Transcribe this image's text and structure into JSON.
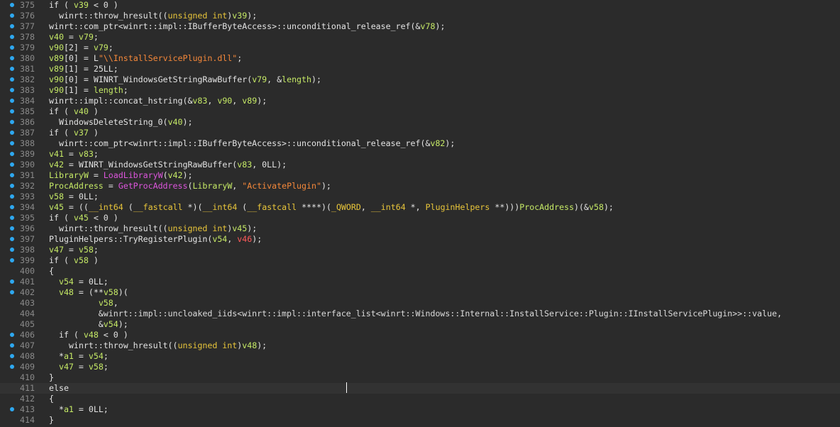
{
  "colors": {
    "background": "#2b2b2b",
    "current_line": "#323232",
    "breakpoint_dot": "#2ea8f0",
    "line_number": "#8a8a8a",
    "plain": "#e3e3e3",
    "variable": "#c6ea66",
    "keyword_type": "#e8c53a",
    "string": "#f5883a",
    "function": "#dd55dd",
    "global": "#dcdcdc",
    "highlight": "#ff5a5a"
  },
  "lines": [
    {
      "num": "375",
      "dot": true,
      "tokens": [
        [
          "p",
          "if ( "
        ],
        [
          "v",
          "v39"
        ],
        [
          "p",
          " < 0 )"
        ]
      ]
    },
    {
      "num": "376",
      "dot": true,
      "tokens": [
        [
          "p",
          "  winrt::throw_hresult(("
        ],
        [
          "k",
          "unsigned int"
        ],
        [
          "p",
          ")"
        ],
        [
          "v",
          "v39"
        ],
        [
          "p",
          ");"
        ]
      ]
    },
    {
      "num": "377",
      "dot": true,
      "tokens": [
        [
          "p",
          "winrt::com_ptr<winrt::impl::IBufferByteAccess>::unconditional_release_ref(&"
        ],
        [
          "v",
          "v78"
        ],
        [
          "p",
          ");"
        ]
      ]
    },
    {
      "num": "378",
      "dot": true,
      "tokens": [
        [
          "v",
          "v40"
        ],
        [
          "p",
          " = "
        ],
        [
          "v",
          "v79"
        ],
        [
          "p",
          ";"
        ]
      ]
    },
    {
      "num": "379",
      "dot": true,
      "tokens": [
        [
          "v",
          "v90"
        ],
        [
          "p",
          "[2] = "
        ],
        [
          "v",
          "v79"
        ],
        [
          "p",
          ";"
        ]
      ]
    },
    {
      "num": "380",
      "dot": true,
      "tokens": [
        [
          "v",
          "v89"
        ],
        [
          "p",
          "[0] = L"
        ],
        [
          "s",
          "\"\\\\InstallServicePlugin.dll\""
        ],
        [
          "p",
          ";"
        ]
      ]
    },
    {
      "num": "381",
      "dot": true,
      "tokens": [
        [
          "v",
          "v89"
        ],
        [
          "p",
          "[1] = 25LL;"
        ]
      ]
    },
    {
      "num": "382",
      "dot": true,
      "tokens": [
        [
          "v",
          "v90"
        ],
        [
          "p",
          "[0] = WINRT_WindowsGetStringRawBuffer("
        ],
        [
          "v",
          "v79"
        ],
        [
          "p",
          ", &"
        ],
        [
          "v",
          "length"
        ],
        [
          "p",
          ");"
        ]
      ]
    },
    {
      "num": "383",
      "dot": true,
      "tokens": [
        [
          "v",
          "v90"
        ],
        [
          "p",
          "[1] = "
        ],
        [
          "v",
          "length"
        ],
        [
          "p",
          ";"
        ]
      ]
    },
    {
      "num": "384",
      "dot": true,
      "tokens": [
        [
          "p",
          "winrt::impl::concat_hstring(&"
        ],
        [
          "v",
          "v83"
        ],
        [
          "p",
          ", "
        ],
        [
          "v",
          "v90"
        ],
        [
          "p",
          ", "
        ],
        [
          "v",
          "v89"
        ],
        [
          "p",
          ");"
        ]
      ]
    },
    {
      "num": "385",
      "dot": true,
      "tokens": [
        [
          "p",
          "if ( "
        ],
        [
          "v",
          "v40"
        ],
        [
          "p",
          " )"
        ]
      ]
    },
    {
      "num": "386",
      "dot": true,
      "tokens": [
        [
          "p",
          "  WindowsDeleteString_0("
        ],
        [
          "v",
          "v40"
        ],
        [
          "p",
          ");"
        ]
      ]
    },
    {
      "num": "387",
      "dot": true,
      "tokens": [
        [
          "p",
          "if ( "
        ],
        [
          "v",
          "v37"
        ],
        [
          "p",
          " )"
        ]
      ]
    },
    {
      "num": "388",
      "dot": true,
      "tokens": [
        [
          "p",
          "  winrt::com_ptr<winrt::impl::IBufferByteAccess>::unconditional_release_ref(&"
        ],
        [
          "v",
          "v82"
        ],
        [
          "p",
          ");"
        ]
      ]
    },
    {
      "num": "389",
      "dot": true,
      "tokens": [
        [
          "v",
          "v41"
        ],
        [
          "p",
          " = "
        ],
        [
          "v",
          "v83"
        ],
        [
          "p",
          ";"
        ]
      ]
    },
    {
      "num": "390",
      "dot": true,
      "tokens": [
        [
          "v",
          "v42"
        ],
        [
          "p",
          " = WINRT_WindowsGetStringRawBuffer("
        ],
        [
          "v",
          "v83"
        ],
        [
          "p",
          ", 0LL);"
        ]
      ]
    },
    {
      "num": "391",
      "dot": true,
      "tokens": [
        [
          "v",
          "LibraryW"
        ],
        [
          "p",
          " = "
        ],
        [
          "f",
          "LoadLibraryW"
        ],
        [
          "p",
          "("
        ],
        [
          "v",
          "v42"
        ],
        [
          "p",
          ");"
        ]
      ]
    },
    {
      "num": "392",
      "dot": true,
      "tokens": [
        [
          "v",
          "ProcAddress"
        ],
        [
          "p",
          " = "
        ],
        [
          "f",
          "GetProcAddress"
        ],
        [
          "p",
          "("
        ],
        [
          "v",
          "LibraryW"
        ],
        [
          "p",
          ", "
        ],
        [
          "s",
          "\"ActivatePlugin\""
        ],
        [
          "p",
          ");"
        ]
      ]
    },
    {
      "num": "393",
      "dot": true,
      "tokens": [
        [
          "v",
          "v58"
        ],
        [
          "p",
          " = 0LL;"
        ]
      ]
    },
    {
      "num": "394",
      "dot": true,
      "tokens": [
        [
          "v",
          "v45"
        ],
        [
          "p",
          " = (("
        ],
        [
          "k",
          "__int64"
        ],
        [
          "p",
          " ("
        ],
        [
          "k",
          "__fastcall"
        ],
        [
          "p",
          " *)("
        ],
        [
          "k",
          "__int64"
        ],
        [
          "p",
          " ("
        ],
        [
          "k",
          "__fastcall"
        ],
        [
          "p",
          " ****)("
        ],
        [
          "k",
          "_QWORD"
        ],
        [
          "p",
          ", "
        ],
        [
          "k",
          "__int64"
        ],
        [
          "p",
          " *, "
        ],
        [
          "k",
          "PluginHelpers"
        ],
        [
          "p",
          " **)))"
        ],
        [
          "v",
          "ProcAddress"
        ],
        [
          "p",
          ")(&"
        ],
        [
          "v",
          "v58"
        ],
        [
          "p",
          ");"
        ]
      ]
    },
    {
      "num": "395",
      "dot": true,
      "tokens": [
        [
          "p",
          "if ( "
        ],
        [
          "v",
          "v45"
        ],
        [
          "p",
          " < 0 )"
        ]
      ]
    },
    {
      "num": "396",
      "dot": true,
      "tokens": [
        [
          "p",
          "  winrt::throw_hresult(("
        ],
        [
          "k",
          "unsigned int"
        ],
        [
          "p",
          ")"
        ],
        [
          "v",
          "v45"
        ],
        [
          "p",
          ");"
        ]
      ]
    },
    {
      "num": "397",
      "dot": true,
      "tokens": [
        [
          "p",
          "PluginHelpers::TryRegisterPlugin("
        ],
        [
          "v",
          "v54"
        ],
        [
          "p",
          ", "
        ],
        [
          "r",
          "v46"
        ],
        [
          "p",
          ");"
        ]
      ]
    },
    {
      "num": "398",
      "dot": true,
      "tokens": [
        [
          "v",
          "v47"
        ],
        [
          "p",
          " = "
        ],
        [
          "v",
          "v58"
        ],
        [
          "p",
          ";"
        ]
      ]
    },
    {
      "num": "399",
      "dot": true,
      "tokens": [
        [
          "p",
          "if ( "
        ],
        [
          "v",
          "v58"
        ],
        [
          "p",
          " )"
        ]
      ]
    },
    {
      "num": "400",
      "dot": false,
      "tokens": [
        [
          "p",
          "{"
        ]
      ]
    },
    {
      "num": "401",
      "dot": true,
      "tokens": [
        [
          "p",
          "  "
        ],
        [
          "v",
          "v54"
        ],
        [
          "p",
          " = 0LL;"
        ]
      ]
    },
    {
      "num": "402",
      "dot": true,
      "tokens": [
        [
          "p",
          "  "
        ],
        [
          "v",
          "v48"
        ],
        [
          "p",
          " = (**"
        ],
        [
          "v",
          "v58"
        ],
        [
          "p",
          ")("
        ]
      ]
    },
    {
      "num": "403",
      "dot": false,
      "tokens": [
        [
          "p",
          "          "
        ],
        [
          "v",
          "v58"
        ],
        [
          "p",
          ","
        ]
      ]
    },
    {
      "num": "404",
      "dot": false,
      "tokens": [
        [
          "p",
          "          &"
        ],
        [
          "g",
          "winrt::impl::uncloaked_iids<winrt::impl::interface_list<winrt::Windows::Internal::InstallService::Plugin::IInstallServicePlugin>>::value"
        ],
        [
          "p",
          ","
        ]
      ]
    },
    {
      "num": "405",
      "dot": false,
      "tokens": [
        [
          "p",
          "          &"
        ],
        [
          "v",
          "v54"
        ],
        [
          "p",
          ");"
        ]
      ]
    },
    {
      "num": "406",
      "dot": true,
      "tokens": [
        [
          "p",
          "  if ( "
        ],
        [
          "v",
          "v48"
        ],
        [
          "p",
          " < 0 )"
        ]
      ]
    },
    {
      "num": "407",
      "dot": true,
      "tokens": [
        [
          "p",
          "    winrt::throw_hresult(("
        ],
        [
          "k",
          "unsigned int"
        ],
        [
          "p",
          ")"
        ],
        [
          "v",
          "v48"
        ],
        [
          "p",
          ");"
        ]
      ]
    },
    {
      "num": "408",
      "dot": true,
      "tokens": [
        [
          "p",
          "  *"
        ],
        [
          "v",
          "a1"
        ],
        [
          "p",
          " = "
        ],
        [
          "v",
          "v54"
        ],
        [
          "p",
          ";"
        ]
      ]
    },
    {
      "num": "409",
      "dot": true,
      "tokens": [
        [
          "p",
          "  "
        ],
        [
          "v",
          "v47"
        ],
        [
          "p",
          " = "
        ],
        [
          "v",
          "v58"
        ],
        [
          "p",
          ";"
        ]
      ]
    },
    {
      "num": "410",
      "dot": false,
      "tokens": [
        [
          "p",
          "}"
        ]
      ]
    },
    {
      "num": "411",
      "dot": false,
      "current": true,
      "tokens": [
        [
          "p",
          "else"
        ]
      ]
    },
    {
      "num": "412",
      "dot": false,
      "tokens": [
        [
          "p",
          "{"
        ]
      ]
    },
    {
      "num": "413",
      "dot": true,
      "tokens": [
        [
          "p",
          "  *"
        ],
        [
          "v",
          "a1"
        ],
        [
          "p",
          " = 0LL;"
        ]
      ]
    },
    {
      "num": "414",
      "dot": false,
      "tokens": [
        [
          "p",
          "}"
        ]
      ]
    }
  ]
}
